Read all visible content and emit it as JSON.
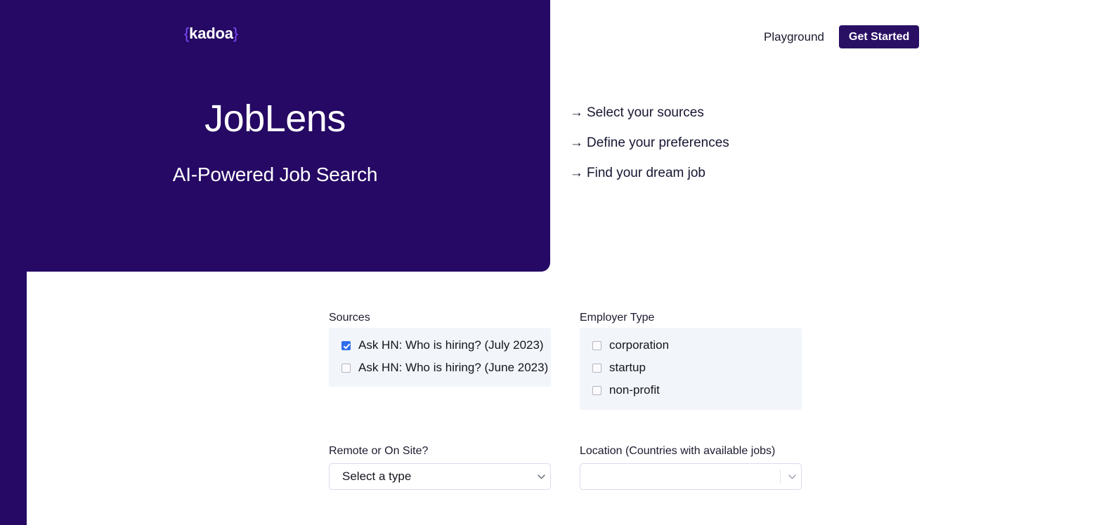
{
  "brand": {
    "logo_open": "{",
    "logo_word": "kadoa",
    "logo_close": "}"
  },
  "nav": {
    "playground_label": "Playground",
    "cta_label": "Get Started"
  },
  "hero": {
    "title": "JobLens",
    "subtitle": "AI-Powered Job Search",
    "background_color": "#250964"
  },
  "steps": [
    {
      "arrow": "→",
      "label": "Select your sources"
    },
    {
      "arrow": "→",
      "label": "Define your preferences"
    },
    {
      "arrow": "→",
      "label": "Find your dream job"
    }
  ],
  "form": {
    "sources": {
      "label": "Sources",
      "options": [
        {
          "label": "Ask HN: Who is hiring? (July 2023)",
          "checked": true
        },
        {
          "label": "Ask HN: Who is hiring? (June 2023)",
          "checked": false
        }
      ]
    },
    "employer_type": {
      "label": "Employer Type",
      "options": [
        {
          "label": "corporation",
          "checked": false
        },
        {
          "label": "startup",
          "checked": false
        },
        {
          "label": "non-profit",
          "checked": false
        }
      ]
    },
    "work_mode": {
      "label": "Remote or On Site?",
      "value": "Select a type",
      "options": [
        "Select a type"
      ]
    },
    "location": {
      "label": "Location (Countries with available jobs)",
      "value": "",
      "placeholder": ""
    }
  },
  "colors": {
    "purple": "#250964",
    "accent_yellow": "#ffe02e",
    "checkbox_blue": "#2f6fed",
    "panel_gray": "#f2f5fa",
    "brace_violet": "#7c4dff"
  }
}
